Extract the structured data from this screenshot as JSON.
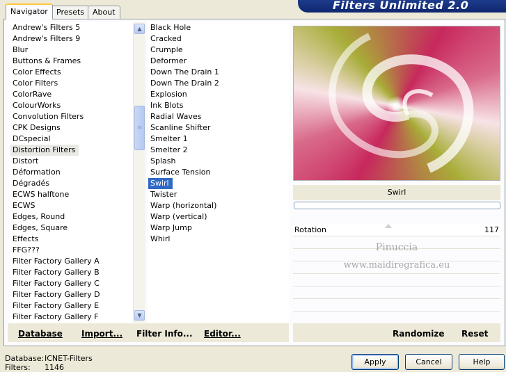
{
  "tabs": [
    {
      "label": "Navigator",
      "active": true
    },
    {
      "label": "Presets",
      "active": false
    },
    {
      "label": "About",
      "active": false
    }
  ],
  "app_title": "Filters Unlimited 2.0",
  "categories": {
    "items": [
      "Andrew's Filters 5",
      "Andrew's Filters 9",
      "Blur",
      "Buttons & Frames",
      "Color Effects",
      "Color Filters",
      "ColorRave",
      "ColourWorks",
      "Convolution Filters",
      "CPK Designs",
      "DCspecial",
      "Distortion Filters",
      "Distort",
      "Déformation",
      "Dégradés",
      "ECWS halftone",
      "ECWS",
      "Edges, Round",
      "Edges, Square",
      "Effects",
      "FFG???",
      "Filter Factory Gallery A",
      "Filter Factory Gallery B",
      "Filter Factory Gallery C",
      "Filter Factory Gallery D",
      "Filter Factory Gallery E",
      "Filter Factory Gallery F"
    ],
    "selected": "Distortion Filters"
  },
  "filters": {
    "items": [
      "Black Hole",
      "Cracked",
      "Crumple",
      "Deformer",
      "Down The Drain 1",
      "Down The Drain 2",
      "Explosion",
      "Ink Blots",
      "Radial Waves",
      "Scanline Shifter",
      "Smelter 1",
      "Smelter 2",
      "Splash",
      "Surface Tension",
      "Swirl",
      "Twister",
      "Warp (horizontal)",
      "Warp (vertical)",
      "Warp Jump",
      "Whirl"
    ],
    "selected": "Swirl"
  },
  "bottom_buttons": {
    "database": "Database",
    "import": "Import...",
    "filter_info": "Filter Info...",
    "editor": "Editor...",
    "randomize": "Randomize",
    "reset": "Reset"
  },
  "preview": {
    "filter_name": "Swirl",
    "progress": 0,
    "colors": {
      "magenta": "#c7285d",
      "olive": "#a8ad38",
      "cream": "#f7e3e6"
    }
  },
  "parameters": [
    {
      "label": "Rotation",
      "value": "117",
      "slider_fraction": 0.46
    }
  ],
  "watermark": {
    "line1": "Pinuccia",
    "line2": "www.maidiregrafica.eu"
  },
  "status": {
    "database_label": "Database:",
    "database_value": "ICNET-Filters",
    "filters_label": "Filters:",
    "filters_value": "1146"
  },
  "dialog_buttons": {
    "apply": "Apply",
    "cancel": "Cancel",
    "help": "Help"
  },
  "icons": {
    "scroll_up": "chevron-up-icon",
    "scroll_down": "chevron-down-icon",
    "grip": "grip-icon"
  }
}
